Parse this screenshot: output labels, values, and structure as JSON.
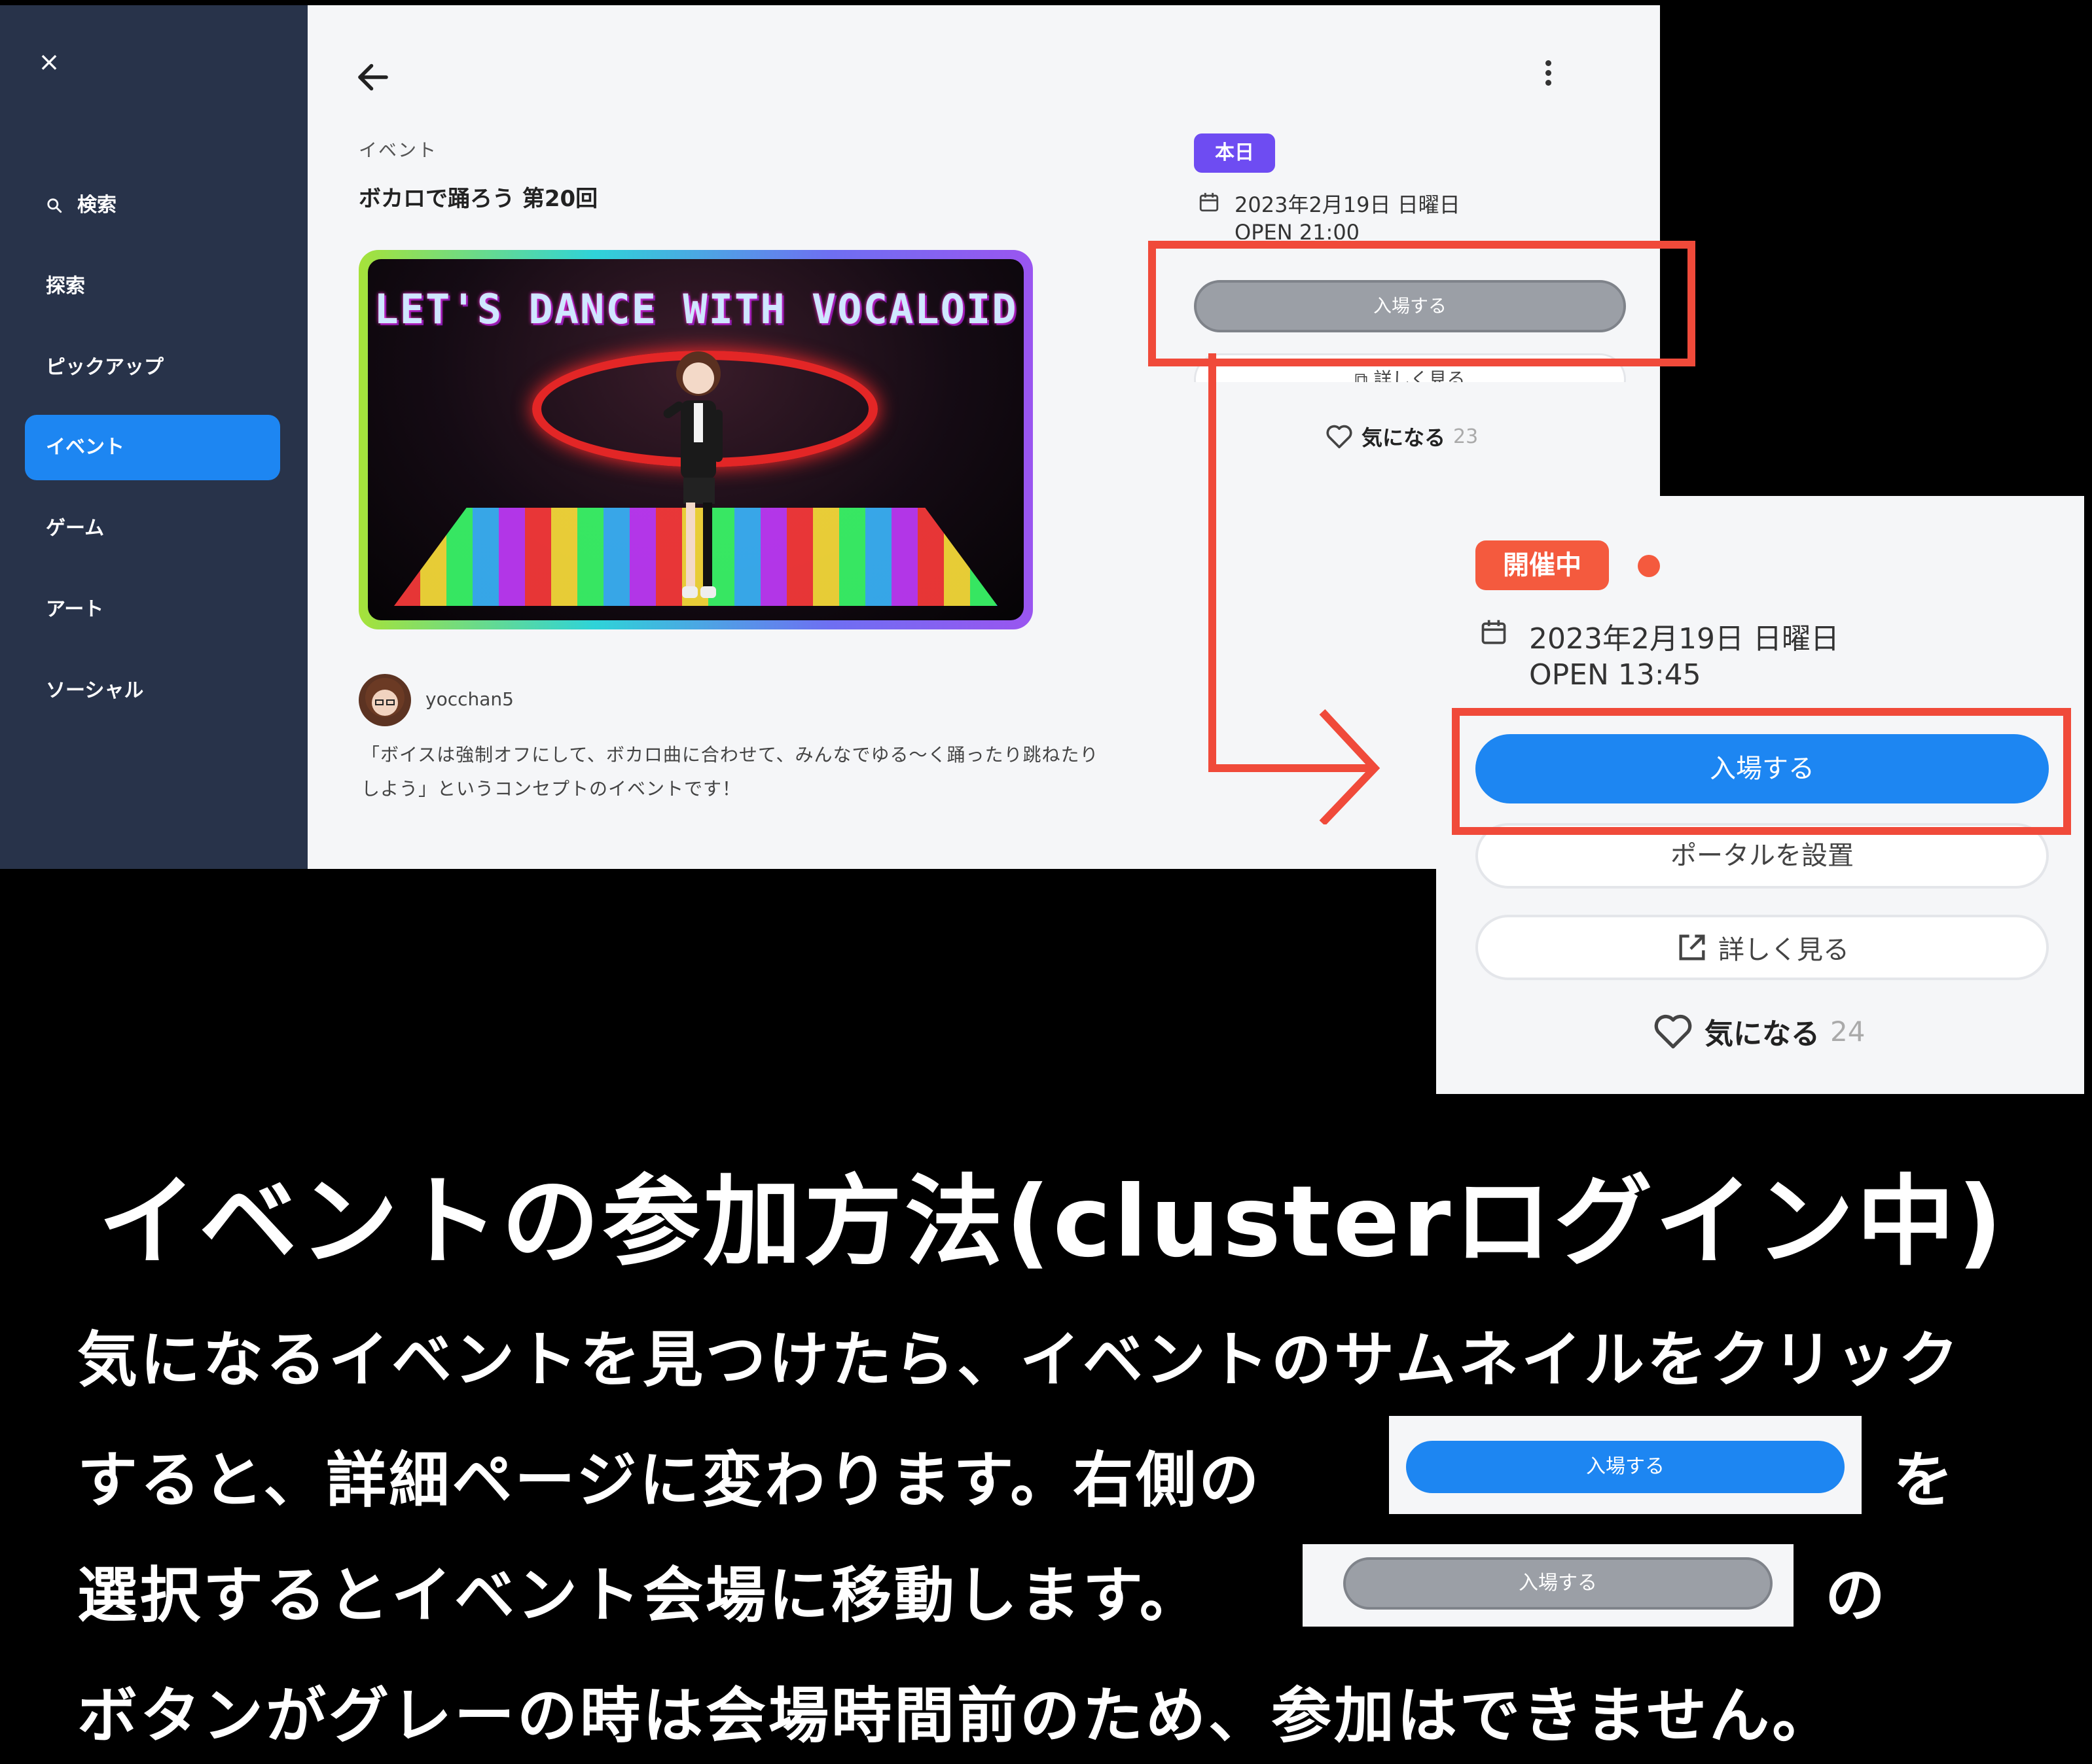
{
  "sidebar": {
    "close_glyph": "×",
    "search_label": "検索",
    "items": [
      {
        "label": "探索"
      },
      {
        "label": "ピックアップ"
      },
      {
        "label": "イベント",
        "active": true
      },
      {
        "label": "ゲーム"
      },
      {
        "label": "アート"
      },
      {
        "label": "ソーシャル"
      }
    ]
  },
  "event": {
    "category": "イベント",
    "title": "ボカロで踊ろう 第20回",
    "thumbnail_text": "LET'S DANCE WITH VOCALOID",
    "author": "yocchan5",
    "description_line1": "「ボイスは強制オフにして、ボカロ曲に合わせて、みんなでゆる〜く踊ったり跳ねたり",
    "description_line2": "しよう」というコンセプトのイベントです！"
  },
  "before": {
    "badge": "本日",
    "date": "2023年2月19日 日曜日",
    "open": "OPEN  21:00",
    "enter_label": "入場する",
    "detail_label": "詳しく見る",
    "favorite_label": "気になる",
    "favorite_count": "23"
  },
  "after": {
    "badge": "開催中",
    "date": "2023年2月19日 日曜日",
    "open": "OPEN  13:45",
    "enter_label": "入場する",
    "portal_label": "ポータルを設置",
    "detail_label": "詳しく見る",
    "favorite_label": "気になる",
    "favorite_count": "24"
  },
  "caption": {
    "heading": "イベントの参加方法(clusterログイン中)",
    "line1": "気になるイベントを見つけたら、イベントのサムネイルをクリック",
    "line2a": "すると、詳細ページに変わります。右側の",
    "line2b": "を",
    "line3a": "選択するとイベント会場に移動します。",
    "line3b": "の",
    "line4": "ボタンがグレーの時は会場時間前のため、参加はできません。",
    "sample_blue_label": "入場する",
    "sample_gray_label": "入場する"
  },
  "colors": {
    "sidebar_bg": "#28334a",
    "accent_blue": "#1d86f2",
    "highlight_red": "#f04a3a",
    "badge_purple": "#6e4cf2",
    "badge_live": "#f45a3e",
    "disabled_gray": "#9b9fa6"
  }
}
